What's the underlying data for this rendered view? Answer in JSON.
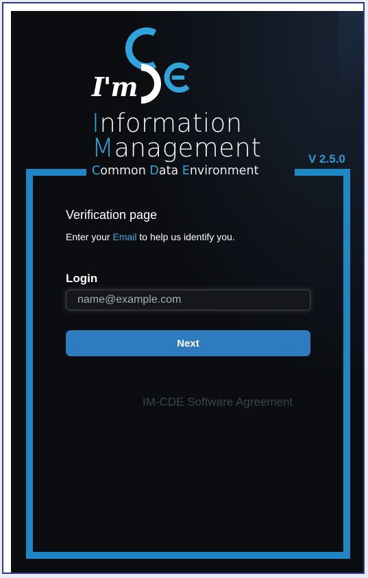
{
  "logo": {
    "prefix": "I'm",
    "mark": "CDE",
    "accent_color": "#2fa3dc"
  },
  "title": {
    "line1_cap": "I",
    "line1_rest": "nformation",
    "line2_cap": "M",
    "line2_rest": "anagement"
  },
  "subtitle": {
    "w1_cap": "C",
    "w1_rest": "ommon ",
    "w2_cap": "D",
    "w2_rest": "ata ",
    "w3_cap": "E",
    "w3_rest": "nvironment"
  },
  "version": "V 2.5.0",
  "verification": {
    "title": "Verification page",
    "desc_before": "Enter your ",
    "desc_highlight": "Email",
    "desc_after": " to help us identify you."
  },
  "login": {
    "label": "Login",
    "placeholder": "name@example.com",
    "value": ""
  },
  "next_button": "Next",
  "agreement_link": "IM-CDE Software Agreement",
  "colors": {
    "frame": "#1f88c4",
    "button": "#2f7bc0",
    "background": "#0b0d10"
  }
}
